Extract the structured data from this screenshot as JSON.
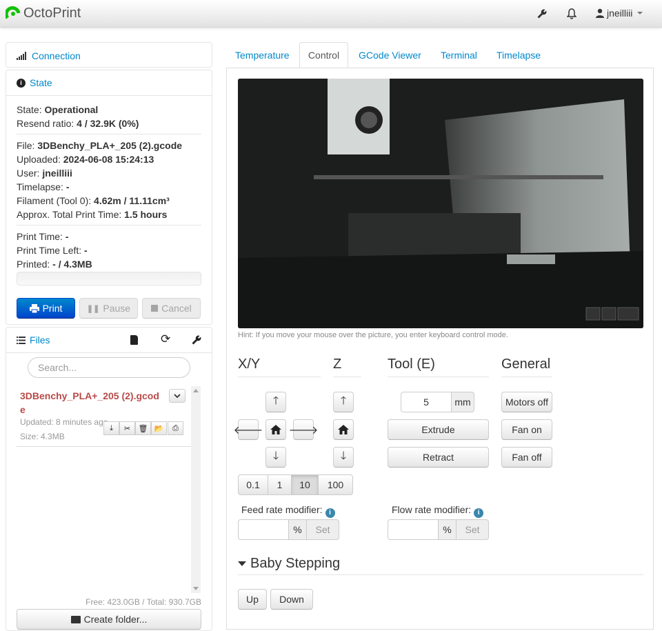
{
  "navbar": {
    "brand": "OctoPrint",
    "settings_icon": "wrench-icon",
    "notifications_icon": "bell-icon",
    "user_icon": "user-icon",
    "username": "jneilliii"
  },
  "sidebar": {
    "connection": {
      "label": "Connection",
      "icon": "signal-icon"
    },
    "state": {
      "label": "State",
      "icon": "info-icon",
      "state_label": "State:",
      "state_value": "Operational",
      "resend_label": "Resend ratio:",
      "resend_value": "4 / 32.9K (0%)",
      "file_label": "File:",
      "file_value": "3DBenchy_PLA+_205 (2).gcode",
      "uploaded_label": "Uploaded:",
      "uploaded_value": "2024-06-08 15:24:13",
      "user_label": "User:",
      "user_value": "jneilliii",
      "timelapse_label": "Timelapse:",
      "timelapse_value": "-",
      "filament_label": "Filament (Tool 0):",
      "filament_value": "4.62m / 11.11cm³",
      "approx_label": "Approx. Total Print Time:",
      "approx_value": "1.5 hours",
      "print_time_label": "Print Time:",
      "print_time_value": "-",
      "time_left_label": "Print Time Left:",
      "time_left_value": "-",
      "printed_label": "Printed:",
      "printed_value": "- / 4.3MB",
      "progress": 0,
      "print_button": "Print",
      "pause_button": "Pause",
      "cancel_button": "Cancel"
    },
    "files": {
      "label": "Files",
      "search_placeholder": "Search...",
      "item": {
        "name_line1": "3DBenchy_PLA+_205 (2).gcod",
        "name_line2": "e",
        "updated": "Updated: 8 minutes ago",
        "size": "Size: 4.3MB"
      },
      "footer": "Free: 423.0GB / Total: 930.7GB",
      "create_folder": "Create folder..."
    }
  },
  "tabs": [
    "Temperature",
    "Control",
    "GCode Viewer",
    "Terminal",
    "Timelapse"
  ],
  "active_tab": "Control",
  "control": {
    "hint": "Hint: If you move your mouse over the picture, you enter keyboard control mode.",
    "xy_title": "X/Y",
    "z_title": "Z",
    "tool_title": "Tool (E)",
    "general_title": "General",
    "steps": [
      "0.1",
      "1",
      "10",
      "100"
    ],
    "active_step": "10",
    "extrude_amount": "5",
    "extrude_unit": "mm",
    "extrude_button": "Extrude",
    "retract_button": "Retract",
    "motors_off": "Motors off",
    "fan_on": "Fan on",
    "fan_off": "Fan off",
    "feed_label": "Feed rate modifier:",
    "flow_label": "Flow rate modifier:",
    "percent": "%",
    "set": "Set",
    "baby_title": "Baby Stepping",
    "up": "Up",
    "down": "Down"
  }
}
